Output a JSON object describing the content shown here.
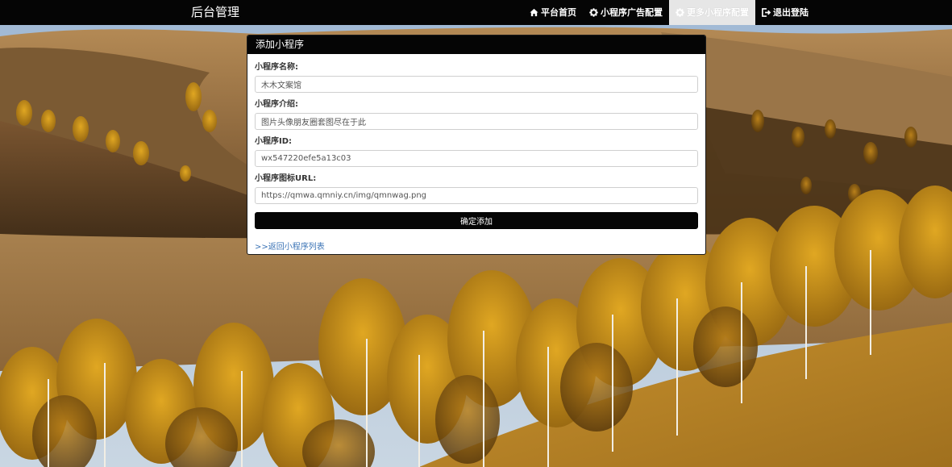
{
  "navbar": {
    "brand": "后台管理",
    "items": [
      {
        "label": "平台首页",
        "icon": "home-icon"
      },
      {
        "label": "小程序广告配置",
        "icon": "gear-icon"
      },
      {
        "label": "更多小程序配置",
        "icon": "gear-icon",
        "active": true
      },
      {
        "label": "退出登陆",
        "icon": "logout-icon"
      }
    ]
  },
  "panel": {
    "title": "添加小程序",
    "fields": [
      {
        "label": "小程序名称:",
        "value": "木木文案馆"
      },
      {
        "label": "小程序介绍:",
        "value": "图片头像朋友圈套图尽在于此"
      },
      {
        "label": "小程序ID:",
        "value": "wx547220efe5a13c03"
      },
      {
        "label": "小程序图标URL:",
        "value": "https://qmwa.qmniy.cn/img/qmnwag.png"
      }
    ],
    "submit_label": "确定添加",
    "back_link": ">>返回小程序列表"
  },
  "colors": {
    "navbar_bg": "#050505",
    "panel_heading_bg": "#050505",
    "link": "#3a73b5",
    "active_tab_bg": "#e6e6e6"
  }
}
